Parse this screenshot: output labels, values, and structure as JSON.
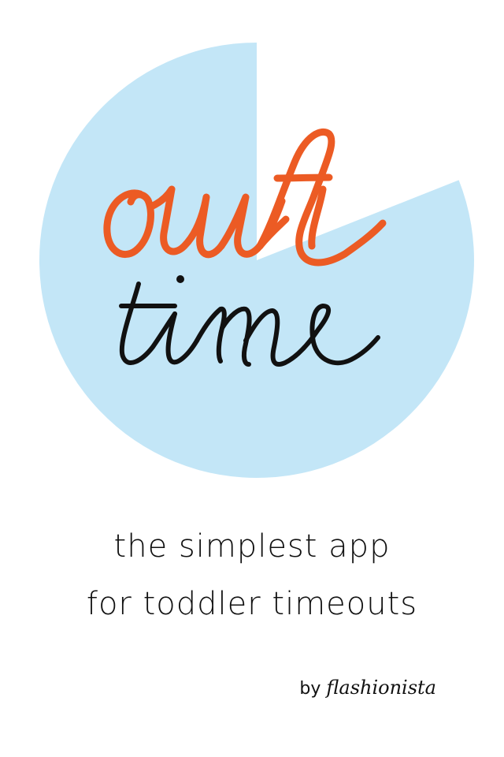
{
  "logo": {
    "timer_remaining_fraction": 0.81,
    "word_top": "out",
    "word_bottom": "time",
    "colors": {
      "timer_fill": "#c3e6f7",
      "word_top": "#ec5b24",
      "word_bottom": "#111111",
      "background": "#ffffff"
    }
  },
  "tagline": {
    "line1": "the simplest app",
    "line2": "for toddler timeouts"
  },
  "byline": {
    "prefix": "by",
    "brand": "flashionista"
  }
}
